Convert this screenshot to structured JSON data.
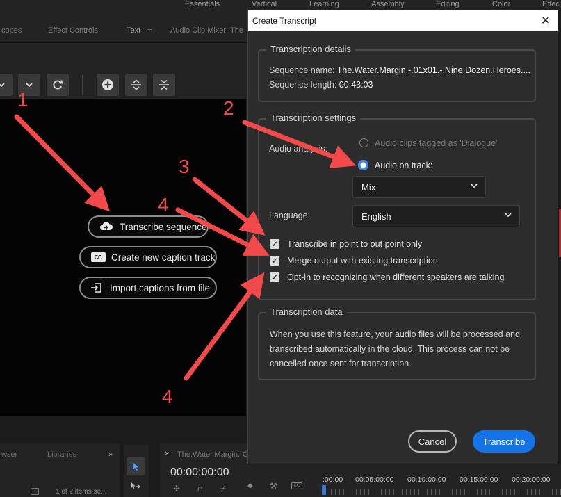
{
  "workspaces": [
    "Essentials",
    "Vertical",
    "Learning",
    "Assembly",
    "Editing",
    "Color",
    "Effec"
  ],
  "left_tabs": [
    "copes",
    "Effect Controls",
    "Text",
    "Audio Clip Mixer: The"
  ],
  "tab_menu_glyph": "≡",
  "caption_buttons": {
    "transcribe": "Transcribe sequence",
    "create_caption": "Create new caption track",
    "import_captions": "Import captions from file",
    "cc_glyph": "CC"
  },
  "bottom_left": {
    "tabs": [
      "wser",
      "Libraries",
      "»"
    ],
    "items_count": "1 of 2 items se..."
  },
  "sequence_panel": {
    "tab_label": "The.Water.Margin.-C",
    "timecode": "00:00:00:00"
  },
  "timeline": {
    "labels": [
      ":00:00",
      "00:05:00:00",
      "00:10:00:00",
      "00:15:00:00",
      "00:20:00:00"
    ]
  },
  "dialog": {
    "title": "Create Transcript",
    "close_glyph": "✕",
    "details": {
      "title": "Transcription details",
      "sequence_name_label": "Sequence name:",
      "sequence_name": "The.Water.Margin.-.01x01.-.Nine.Dozen.Heroes....",
      "sequence_length_label": "Sequence length:",
      "sequence_length": "00:43:03"
    },
    "settings": {
      "title": "Transcription settings",
      "audio_analysis_label": "Audio analysis:",
      "radio_dialogue": "Audio clips tagged as 'Dialogue'",
      "radio_track": "Audio on track:",
      "track_value": "Mix",
      "language_label": "Language:",
      "language_value": "English",
      "check_inout": "Transcribe in point to out point only",
      "check_merge": "Merge output with existing transcription",
      "check_speakers": "Opt-in to recognizing when different speakers are talking"
    },
    "data": {
      "title": "Transcription data",
      "text": "When you use this feature, your audio files will be processed and transcribed automatically in the cloud. This process can not be cancelled once sent for transcription."
    },
    "cancel_label": "Cancel",
    "transcribe_label": "Transcribe"
  },
  "annotations": {
    "numbers": [
      "1",
      "2",
      "3",
      "4",
      "4"
    ],
    "arrow_color": "#f24a4a"
  }
}
